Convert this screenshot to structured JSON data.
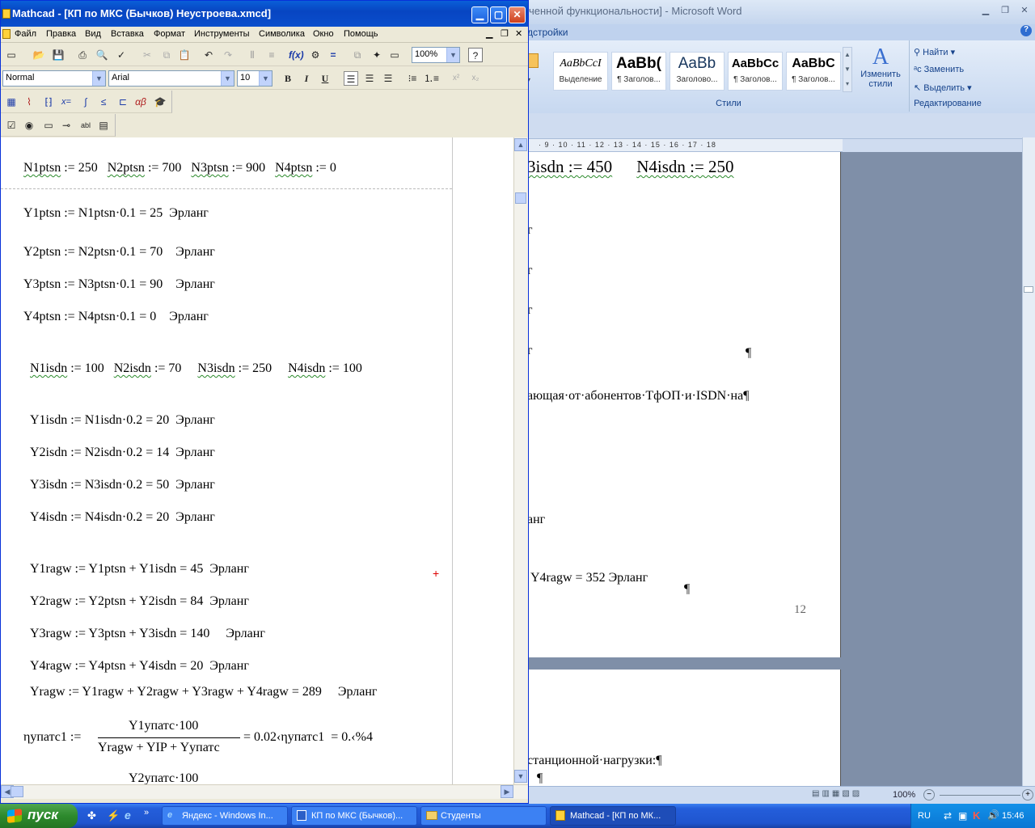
{
  "word": {
    "title": "ченной функциональности] - Microsoft Word",
    "tab_addins": "дстройки",
    "styles": [
      {
        "sample": "AaBbCcI",
        "label": "Выделение"
      },
      {
        "sample": "AaBb(",
        "label": "¶ Заголов..."
      },
      {
        "sample": "AaBb",
        "label": "Заголово..."
      },
      {
        "sample": "AaBbCc",
        "label": "¶ Заголов..."
      },
      {
        "sample": "AaBbC",
        "label": "¶ Заголов..."
      }
    ],
    "change_styles": "Изменить стили",
    "group_styles": "Стили",
    "find": "Найти",
    "replace": "Заменить",
    "select": "Выделить",
    "group_editing": "Редактирование",
    "ruler": "· 9 · 10 · 11 · 12 · 13 · 14 · 15 · 16 · 17 · 18",
    "doc_lines": {
      "line1_a": "3isdn := 450",
      "line1_b": "N4isdn := 250",
      "frag1": "г",
      "frag2": "г",
      "frag3": "г",
      "frag4": "г",
      "pilcrow1": "¶",
      "para1": "ающая·от·абонентов·ТфОП·и·ISDN·на¶",
      "frag5": "анг",
      "y4ragw": "Y4ragw = 352  Эрланг",
      "pilcrow2": "¶",
      "page_num": "12",
      "para2": "станционной·нагрузки:¶",
      "pilcrow3": "¶"
    },
    "zoom": "100%"
  },
  "mathcad": {
    "title": "Mathcad - [КП по МКС (Бычков) Неустроева.xmcd]",
    "menu": [
      "Файл",
      "Правка",
      "Вид",
      "Вставка",
      "Формат",
      "Инструменты",
      "Символика",
      "Окно",
      "Помощь"
    ],
    "zoom": "100%",
    "style": "Normal",
    "font": "Arial",
    "size": "10",
    "lines": {
      "n_ptsn": {
        "a": "N1ptsn",
        "b": " := 250   ",
        "c": "N2ptsn",
        "d": " := 700   ",
        "e": "N3ptsn",
        "f": " := 900   ",
        "g": "N4ptsn",
        "h": " := 0"
      },
      "y1ptsn": "Y1ptsn := N1ptsn·0.1 = 25  Эрланг",
      "y2ptsn": "Y2ptsn := N2ptsn·0.1 = 70    Эрланг",
      "y3ptsn": "Y3ptsn := N3ptsn·0.1 = 90    Эрланг",
      "y4ptsn": "Y4ptsn := N4ptsn·0.1 = 0    Эрланг",
      "n_isdn": {
        "a": "N1isdn",
        "b": " := 100   ",
        "c": "N2isdn",
        "d": " := 70     ",
        "e": "N3isdn",
        "f": " := 250     ",
        "g": "N4isdn",
        "h": " := 100"
      },
      "y1isdn": "Y1isdn := N1isdn·0.2 = 20  Эрланг",
      "y2isdn": "Y2isdn := N2isdn·0.2 = 14  Эрланг",
      "y3isdn": "Y3isdn := N3isdn·0.2 = 50  Эрланг",
      "y4isdn": "Y4isdn := N4isdn·0.2 = 20  Эрланг",
      "y1ragw": "Y1ragw := Y1ptsn + Y1isdn = 45  Эрланг",
      "y2ragw": "Y2ragw := Y2ptsn + Y2isdn = 84  Эрланг",
      "y3ragw": "Y3ragw := Y3ptsn + Y3isdn = 140     Эрланг",
      "y4ragw": "Y4ragw := Y4ptsn + Y4isdn = 20  Эрланг",
      "yragw": "Yragw := Y1ragw + Y2ragw + Y3ragw + Y4ragw = 289     Эрланг",
      "eta_lhs": "ηупатс1 :=",
      "eta_num": "Y1упатс·100",
      "eta_den": "Yragw + YIP + Yупатс",
      "eta_rhs": "= 0.02‹ηупатс1  = 0.‹%4",
      "y2upats": "Y2упатс·100"
    }
  },
  "taskbar": {
    "start": "пуск",
    "tasks": [
      "Яндекс - Windows In...",
      "КП по МКС (Бычков)...",
      "Студенты",
      "Mathcad - [КП по МК..."
    ],
    "lang": "RU",
    "clock": "15:46"
  }
}
